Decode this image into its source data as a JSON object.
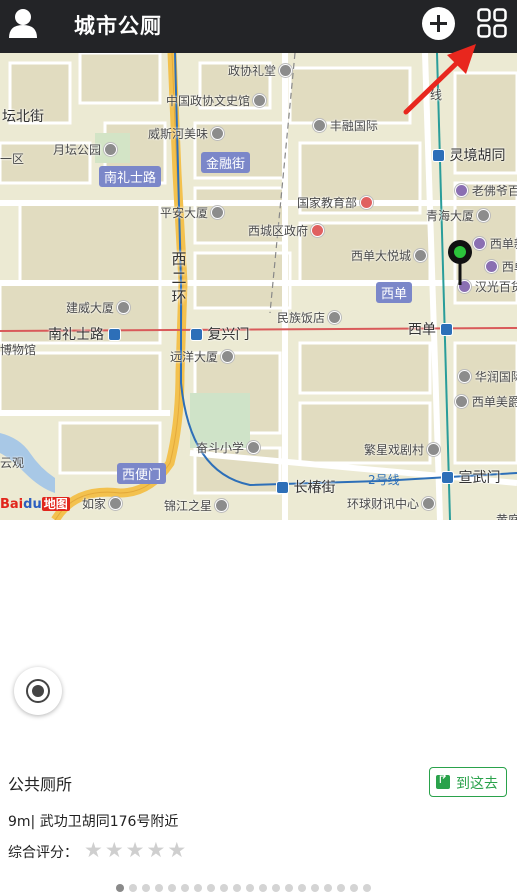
{
  "header": {
    "title": "城市公厕",
    "avatar_icon": "user-icon",
    "add_icon": "plus-icon",
    "menu_icon": "grid-icon"
  },
  "map": {
    "roads": [
      "南礼士路",
      "复兴门",
      "西单",
      "长椿街",
      "宣武门",
      "2号线",
      "线"
    ],
    "ring_road": [
      "西",
      "二",
      "环"
    ],
    "area_tags": [
      "南礼士路",
      "金融街",
      "西单",
      "西便门"
    ],
    "pois": [
      "政协礼堂",
      "中国政协文史馆",
      "丰融国际",
      "威斯河美味",
      "月坛公园",
      "平安大厦",
      "国家教育部",
      "西城区政府",
      "建威大厦",
      "西单大悦城",
      "民族饭店",
      "远洋大厦",
      "奋斗小学",
      "繁星戏剧村",
      "锦江之星",
      "如家",
      "环球财讯中心",
      "灵境胡同",
      "老佛爷百",
      "青海大厦",
      "西单新",
      "西单明",
      "汉光百货",
      "华润国际",
      "西单美爵"
    ],
    "edge_labels": [
      "坛北街",
      "一区",
      "博物馆",
      "云观",
      "黄庭"
    ],
    "baidu": {
      "b1": "Bai",
      "b2": "du",
      "b3": "地图"
    }
  },
  "info": {
    "title": "公共厕所",
    "goto_label": "到这去",
    "address": "9m| 武功卫胡同176号附近",
    "rating_label": "综合评分：",
    "rating": 0,
    "rating_max": 5
  },
  "pager": {
    "count": 20,
    "active": 0
  },
  "colors": {
    "header_bg": "#232427",
    "accent_green": "#2aa24b",
    "pin_green": "#2cc33b",
    "arrow_red": "#e8271e"
  }
}
